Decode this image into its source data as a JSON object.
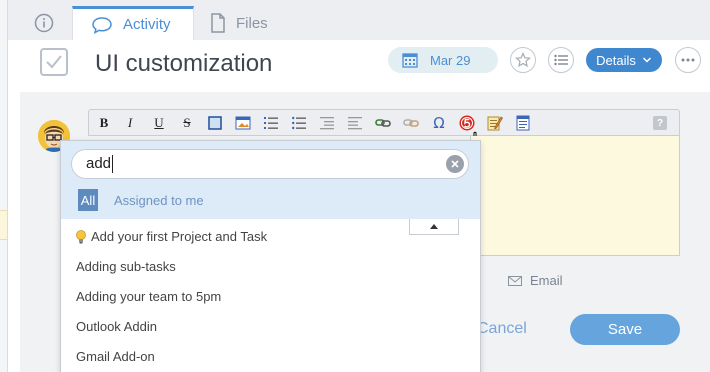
{
  "tabs": {
    "info_icon": "info-icon",
    "activity_label": "Activity",
    "files_label": "Files"
  },
  "header": {
    "title": "UI customization",
    "due_date": "Mar 29",
    "details_label": "Details"
  },
  "comment": {
    "email_label": "Email",
    "cancel_label": "Cancel",
    "save_label": "Save",
    "toolbar_buttons": [
      "B",
      "I",
      "U",
      "S",
      "?"
    ],
    "omega": "Ω"
  },
  "picker": {
    "search_value": "add",
    "filter_all": "All",
    "filter_assigned": "Assigned to me",
    "results": [
      "Add your first Project and Task",
      "Adding sub-tasks",
      "Adding your team to 5pm",
      "Outlook Addin",
      "Gmail Add-on"
    ]
  },
  "colors": {
    "accent": "#4a8fd6",
    "details_button": "#3f88d0",
    "save_button": "#66a4dd",
    "editor_bg": "#fdf9df",
    "picker_header": "#ddeaf8"
  }
}
